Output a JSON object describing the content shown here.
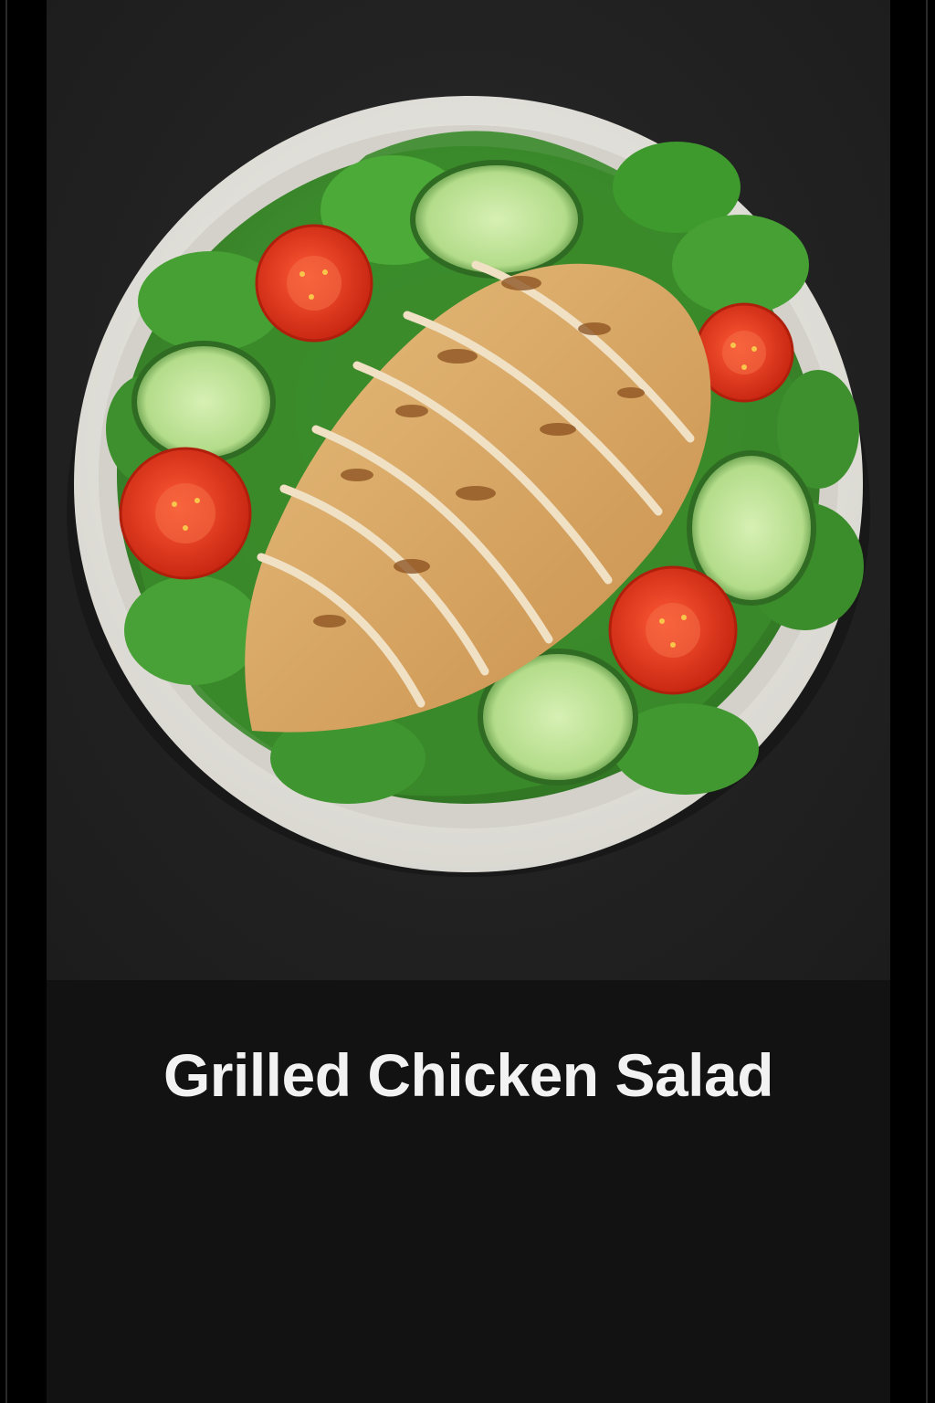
{
  "app": {
    "title": "Grilled Chicken Salad"
  },
  "hero": {
    "image_subject": "salad-bowl-illustration"
  },
  "colors": {
    "background": "#000000",
    "screen": "#121212",
    "title_text": "#f2f2f2",
    "chicken": "#d9a863",
    "lettuce": "#3f8f2f",
    "cucumber": "#bfe39a",
    "tomato": "#e23a1f",
    "bowl": "#ecebe6"
  }
}
